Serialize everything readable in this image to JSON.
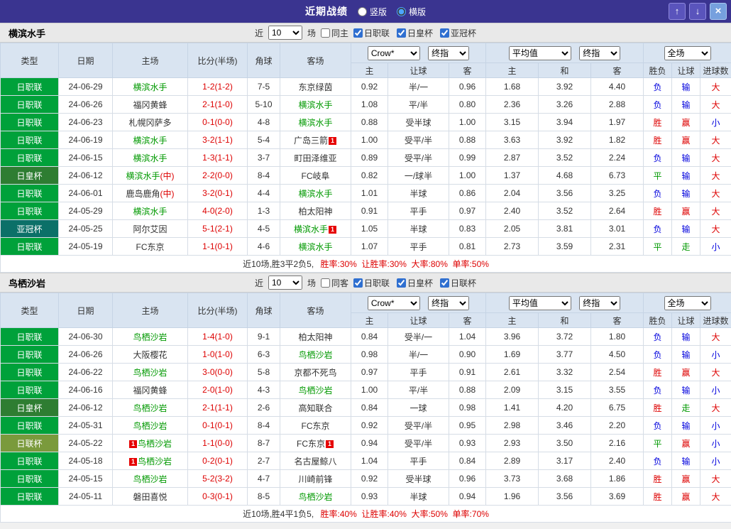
{
  "titlebar": {
    "title": "近期战绩",
    "layout_options": [
      {
        "label": "竖版",
        "selected": false
      },
      {
        "label": "横版",
        "selected": true
      }
    ],
    "up_button": "↑",
    "down_button": "↓",
    "close_button": "×"
  },
  "columns": {
    "type": "类型",
    "date": "日期",
    "home": "主场",
    "score": "比分(半场)",
    "corner": "角球",
    "away": "客场",
    "odds_home": "主",
    "odds_handicap": "让球",
    "odds_away": "客",
    "avg_home": "主",
    "avg_draw": "和",
    "avg_away": "客",
    "result": "胜负",
    "handicap_result": "让球",
    "goals": "进球数"
  },
  "league_colors": {
    "日职联": "#00a13a",
    "日皇杯": "#2e7d32",
    "亚冠杯": "#0b7068",
    "日联杯": "#7a9a3c"
  },
  "result_colors": {
    "胜": "#dd0000",
    "赢": "#dd0000",
    "大": "#dd0000",
    "负": "#0000dd",
    "输": "#0000dd",
    "小": "#0000dd",
    "平": "#009900",
    "走": "#009900"
  },
  "red_card_label": "1",
  "sections": [
    {
      "team": "横滨水手",
      "filter": {
        "prefix": "近",
        "count": "10",
        "suffix": "场",
        "same": {
          "label": "同主",
          "checked": false
        },
        "leagues": [
          {
            "label": "日职联",
            "checked": true
          },
          {
            "label": "日皇杯",
            "checked": true
          },
          {
            "label": "亚冠杯",
            "checked": true
          }
        ]
      },
      "selectors": {
        "book": "Crow*",
        "book_time": "终指",
        "avg": "平均值",
        "avg_time": "终指",
        "scope": "全场"
      },
      "rows": [
        {
          "league": "日职联",
          "date": "24-06-29",
          "home": {
            "name": "横滨水手",
            "focal": true
          },
          "score": "1-2(1-2)",
          "corner": "7-5",
          "away": {
            "name": "东京绿茵"
          },
          "odds": [
            "0.92",
            "半/一",
            "0.96"
          ],
          "avg": [
            "1.68",
            "3.92",
            "4.40"
          ],
          "results": [
            "负",
            "输",
            "大"
          ]
        },
        {
          "league": "日职联",
          "date": "24-06-26",
          "home": {
            "name": "福冈黄蜂"
          },
          "score": "2-1(1-0)",
          "corner": "5-10",
          "away": {
            "name": "横滨水手",
            "focal": true
          },
          "odds": [
            "1.08",
            "平/半",
            "0.80"
          ],
          "avg": [
            "2.36",
            "3.26",
            "2.88"
          ],
          "results": [
            "负",
            "输",
            "大"
          ]
        },
        {
          "league": "日职联",
          "date": "24-06-23",
          "home": {
            "name": "札幌冈萨多"
          },
          "score": "0-1(0-0)",
          "corner": "4-8",
          "away": {
            "name": "横滨水手",
            "focal": true
          },
          "odds": [
            "0.88",
            "受半球",
            "1.00"
          ],
          "avg": [
            "3.15",
            "3.94",
            "1.97"
          ],
          "results": [
            "胜",
            "赢",
            "小"
          ]
        },
        {
          "league": "日职联",
          "date": "24-06-19",
          "home": {
            "name": "横滨水手",
            "focal": true
          },
          "score": "3-2(1-1)",
          "corner": "5-4",
          "away": {
            "name": "广岛三箭",
            "badge": "after"
          },
          "odds": [
            "1.00",
            "受平/半",
            "0.88"
          ],
          "avg": [
            "3.63",
            "3.92",
            "1.82"
          ],
          "results": [
            "胜",
            "赢",
            "大"
          ]
        },
        {
          "league": "日职联",
          "date": "24-06-15",
          "home": {
            "name": "横滨水手",
            "focal": true
          },
          "score": "1-3(1-1)",
          "corner": "3-7",
          "away": {
            "name": "町田泽维亚"
          },
          "odds": [
            "0.89",
            "受平/半",
            "0.99"
          ],
          "avg": [
            "2.87",
            "3.52",
            "2.24"
          ],
          "results": [
            "负",
            "输",
            "大"
          ]
        },
        {
          "league": "日皇杯",
          "date": "24-06-12",
          "home": {
            "name": "横滨水手",
            "focal": true,
            "suffix": "(中)"
          },
          "score": "2-2(0-0)",
          "corner": "8-4",
          "away": {
            "name": "FC岐阜"
          },
          "odds": [
            "0.82",
            "一/球半",
            "1.00"
          ],
          "avg": [
            "1.37",
            "4.68",
            "6.73"
          ],
          "results": [
            "平",
            "输",
            "大"
          ]
        },
        {
          "league": "日职联",
          "date": "24-06-01",
          "home": {
            "name": "鹿岛鹿角",
            "suffix": "(中)"
          },
          "score": "3-2(0-1)",
          "corner": "4-4",
          "away": {
            "name": "横滨水手",
            "focal": true
          },
          "odds": [
            "1.01",
            "半球",
            "0.86"
          ],
          "avg": [
            "2.04",
            "3.56",
            "3.25"
          ],
          "results": [
            "负",
            "输",
            "大"
          ]
        },
        {
          "league": "日职联",
          "date": "24-05-29",
          "home": {
            "name": "横滨水手",
            "focal": true
          },
          "score": "4-0(2-0)",
          "corner": "1-3",
          "away": {
            "name": "柏太阳神"
          },
          "odds": [
            "0.91",
            "平手",
            "0.97"
          ],
          "avg": [
            "2.40",
            "3.52",
            "2.64"
          ],
          "results": [
            "胜",
            "赢",
            "大"
          ]
        },
        {
          "league": "亚冠杯",
          "date": "24-05-25",
          "home": {
            "name": "阿尔艾因"
          },
          "score": "5-1(2-1)",
          "corner": "4-5",
          "away": {
            "name": "横滨水手",
            "focal": true,
            "badge": "after"
          },
          "odds": [
            "1.05",
            "半球",
            "0.83"
          ],
          "avg": [
            "2.05",
            "3.81",
            "3.01"
          ],
          "results": [
            "负",
            "输",
            "大"
          ]
        },
        {
          "league": "日职联",
          "date": "24-05-19",
          "home": {
            "name": "FC东京"
          },
          "score": "1-1(0-1)",
          "corner": "4-6",
          "away": {
            "name": "横滨水手",
            "focal": true
          },
          "odds": [
            "1.07",
            "平手",
            "0.81"
          ],
          "avg": [
            "2.73",
            "3.59",
            "2.31"
          ],
          "results": [
            "平",
            "走",
            "小"
          ]
        }
      ],
      "summary": {
        "prefix": "近10场,胜3平2负5,",
        "stats": "胜率:30%  让胜率:30%  大率:80%  单率:50%"
      }
    },
    {
      "team": "鸟栖沙岩",
      "filter": {
        "prefix": "近",
        "count": "10",
        "suffix": "场",
        "same": {
          "label": "同客",
          "checked": false
        },
        "leagues": [
          {
            "label": "日职联",
            "checked": true
          },
          {
            "label": "日皇杯",
            "checked": true
          },
          {
            "label": "日联杯",
            "checked": true
          }
        ]
      },
      "selectors": {
        "book": "Crow*",
        "book_time": "终指",
        "avg": "平均值",
        "avg_time": "终指",
        "scope": "全场"
      },
      "rows": [
        {
          "league": "日职联",
          "date": "24-06-30",
          "home": {
            "name": "鸟栖沙岩",
            "focal": true
          },
          "score": "1-4(1-0)",
          "corner": "9-1",
          "away": {
            "name": "柏太阳神"
          },
          "odds": [
            "0.84",
            "受半/一",
            "1.04"
          ],
          "avg": [
            "3.96",
            "3.72",
            "1.80"
          ],
          "results": [
            "负",
            "输",
            "大"
          ]
        },
        {
          "league": "日职联",
          "date": "24-06-26",
          "home": {
            "name": "大阪樱花"
          },
          "score": "1-0(1-0)",
          "corner": "6-3",
          "away": {
            "name": "鸟栖沙岩",
            "focal": true
          },
          "odds": [
            "0.98",
            "半/一",
            "0.90"
          ],
          "avg": [
            "1.69",
            "3.77",
            "4.50"
          ],
          "results": [
            "负",
            "输",
            "小"
          ]
        },
        {
          "league": "日职联",
          "date": "24-06-22",
          "home": {
            "name": "鸟栖沙岩",
            "focal": true
          },
          "score": "3-0(0-0)",
          "corner": "5-8",
          "away": {
            "name": "京都不死鸟"
          },
          "odds": [
            "0.97",
            "平手",
            "0.91"
          ],
          "avg": [
            "2.61",
            "3.32",
            "2.54"
          ],
          "results": [
            "胜",
            "赢",
            "大"
          ]
        },
        {
          "league": "日职联",
          "date": "24-06-16",
          "home": {
            "name": "福冈黄蜂"
          },
          "score": "2-0(1-0)",
          "corner": "4-3",
          "away": {
            "name": "鸟栖沙岩",
            "focal": true
          },
          "odds": [
            "1.00",
            "平/半",
            "0.88"
          ],
          "avg": [
            "2.09",
            "3.15",
            "3.55"
          ],
          "results": [
            "负",
            "输",
            "小"
          ]
        },
        {
          "league": "日皇杯",
          "date": "24-06-12",
          "home": {
            "name": "鸟栖沙岩",
            "focal": true
          },
          "score": "2-1(1-1)",
          "corner": "2-6",
          "away": {
            "name": "高知联合"
          },
          "odds": [
            "0.84",
            "一球",
            "0.98"
          ],
          "avg": [
            "1.41",
            "4.20",
            "6.75"
          ],
          "results": [
            "胜",
            "走",
            "大"
          ]
        },
        {
          "league": "日职联",
          "date": "24-05-31",
          "home": {
            "name": "鸟栖沙岩",
            "focal": true
          },
          "score": "0-1(0-1)",
          "corner": "8-4",
          "away": {
            "name": "FC东京"
          },
          "odds": [
            "0.92",
            "受平/半",
            "0.95"
          ],
          "avg": [
            "2.98",
            "3.46",
            "2.20"
          ],
          "results": [
            "负",
            "输",
            "小"
          ]
        },
        {
          "league": "日联杯",
          "date": "24-05-22",
          "home": {
            "name": "鸟栖沙岩",
            "focal": true,
            "badge": "before"
          },
          "score": "1-1(0-0)",
          "corner": "8-7",
          "away": {
            "name": "FC东京",
            "badge": "after"
          },
          "odds": [
            "0.94",
            "受平/半",
            "0.93"
          ],
          "avg": [
            "2.93",
            "3.50",
            "2.16"
          ],
          "results": [
            "平",
            "赢",
            "小"
          ]
        },
        {
          "league": "日职联",
          "date": "24-05-18",
          "home": {
            "name": "鸟栖沙岩",
            "focal": true,
            "badge": "before"
          },
          "score": "0-2(0-1)",
          "corner": "2-7",
          "away": {
            "name": "名古屋鲸八"
          },
          "odds": [
            "1.04",
            "平手",
            "0.84"
          ],
          "avg": [
            "2.89",
            "3.17",
            "2.40"
          ],
          "results": [
            "负",
            "输",
            "小"
          ]
        },
        {
          "league": "日职联",
          "date": "24-05-15",
          "home": {
            "name": "鸟栖沙岩",
            "focal": true
          },
          "score": "5-2(3-2)",
          "corner": "4-7",
          "away": {
            "name": "川崎前锋"
          },
          "odds": [
            "0.92",
            "受半球",
            "0.96"
          ],
          "avg": [
            "3.73",
            "3.68",
            "1.86"
          ],
          "results": [
            "胜",
            "赢",
            "大"
          ]
        },
        {
          "league": "日职联",
          "date": "24-05-11",
          "home": {
            "name": "磐田喜悦"
          },
          "score": "0-3(0-1)",
          "corner": "8-5",
          "away": {
            "name": "鸟栖沙岩",
            "focal": true
          },
          "odds": [
            "0.93",
            "半球",
            "0.94"
          ],
          "avg": [
            "1.96",
            "3.56",
            "3.69"
          ],
          "results": [
            "胜",
            "赢",
            "大"
          ]
        }
      ],
      "summary": {
        "prefix": "近10场,胜4平1负5,",
        "stats": "胜率:40%  让胜率:40%  大率:50%  单率:70%"
      }
    }
  ]
}
